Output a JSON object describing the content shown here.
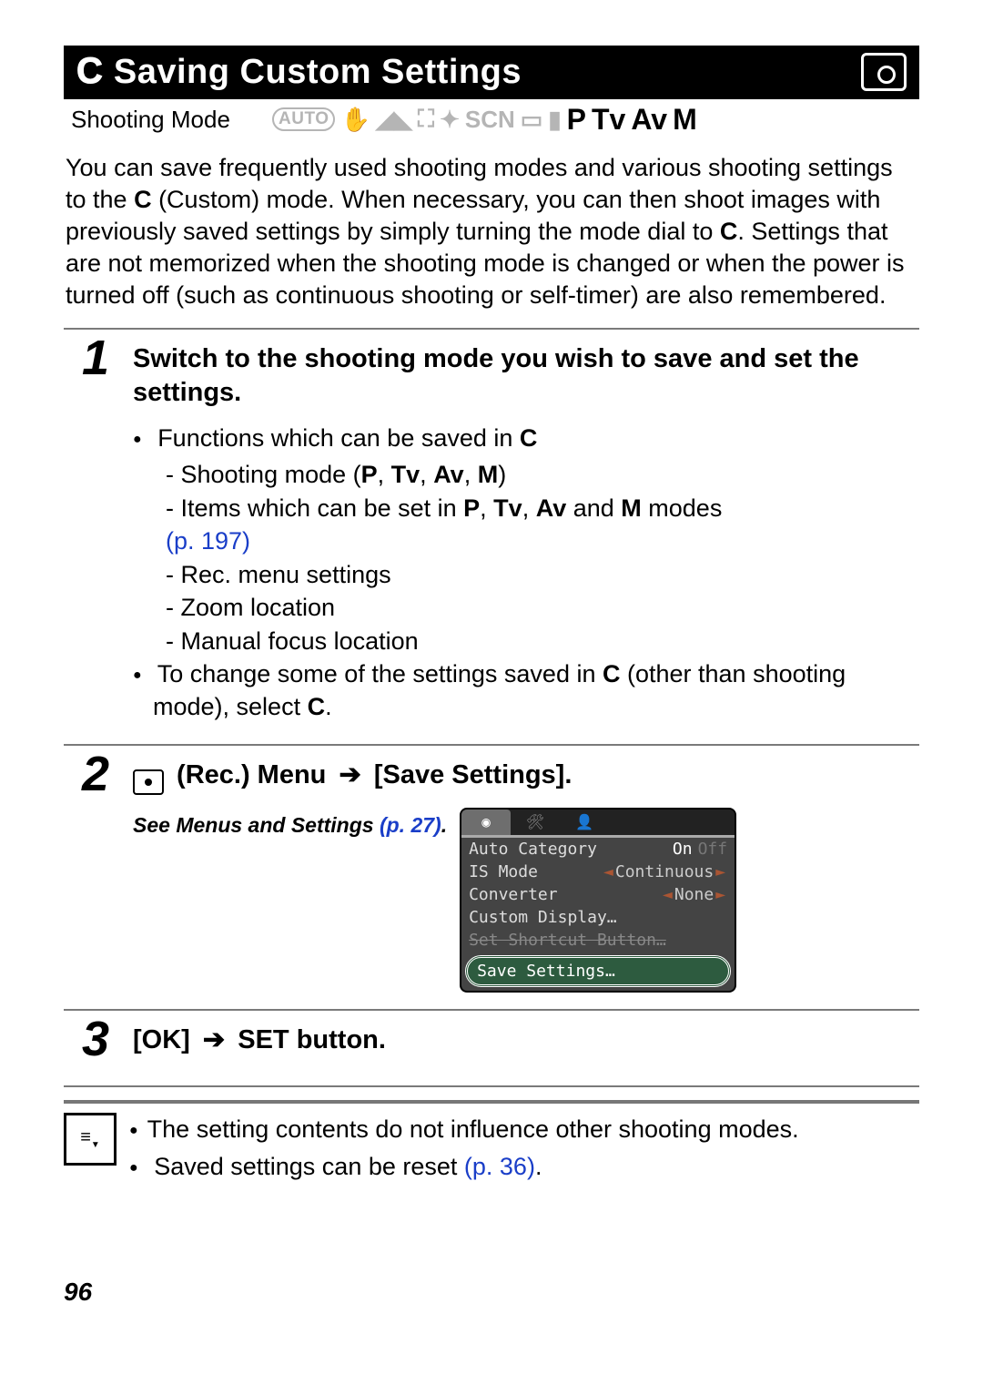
{
  "header": {
    "c_glyph": "C",
    "title": "Saving Custom Settings"
  },
  "mode_row": {
    "label": "Shooting Mode",
    "dim_auto": "AUTO",
    "dim_scn": "SCN",
    "active": [
      "P",
      "Tv",
      "Av",
      "M"
    ]
  },
  "intro_parts": {
    "p1": "You can save frequently used shooting modes and various shooting settings to the ",
    "c1": "C",
    "p2": " (Custom) mode. When necessary, you can then shoot images with previously saved settings by simply turning the mode dial to ",
    "c2": "C",
    "p3": ". Settings that are not memorized when the shooting mode is changed or when the power is turned off (such as continuous shooting or self-timer) are also remembered."
  },
  "steps": {
    "s1": {
      "num": "1",
      "head": "Switch to the shooting mode you wish to save and set the settings.",
      "b1a": "Functions which can be saved in ",
      "b1b": "C",
      "d1": "- Shooting mode (",
      "d1_modes": [
        "P",
        "Tv",
        "Av",
        "M"
      ],
      "d1_close": ")",
      "d2a": "- Items which can be set in ",
      "d2_modes": [
        "P",
        "Tv",
        "Av"
      ],
      "d2_and": " and ",
      "d2_m": "M",
      "d2_tail": " modes",
      "d2_ref": "(p. 197)",
      "d3": "- Rec. menu settings",
      "d4": "- Zoom location",
      "d5": "- Manual focus location",
      "b2a": "To change some of the settings saved in ",
      "b2b": "C",
      "b2c": " (other than shooting mode), select ",
      "b2d": "C",
      "b2e": "."
    },
    "s2": {
      "num": "2",
      "head_rec": " (Rec.) Menu ",
      "head_arrow": "➔",
      "head_tail": " [Save Settings].",
      "see": "See Menus and Settings ",
      "see_ref": "(p. 27)",
      "see_dot": ".",
      "menu": {
        "auto_cat": "Auto Category",
        "auto_cat_on": "On",
        "auto_cat_off": "Off",
        "is_mode": "IS Mode",
        "is_val": "Continuous",
        "converter": "Converter",
        "conv_val": "None",
        "custom_disp": "Custom Display…",
        "strike": "Set Shortcut Button…",
        "save": "Save Settings…"
      }
    },
    "s3": {
      "num": "3",
      "head_ok": "[OK] ",
      "head_arrow": "➔",
      "head_set": " SET",
      "head_tail": " button."
    }
  },
  "notes": {
    "n1": "The setting contents do not influence other shooting modes.",
    "n2a": "Saved settings can be reset ",
    "n2_ref": "(p. 36)",
    "n2b": "."
  },
  "page_number": "96"
}
